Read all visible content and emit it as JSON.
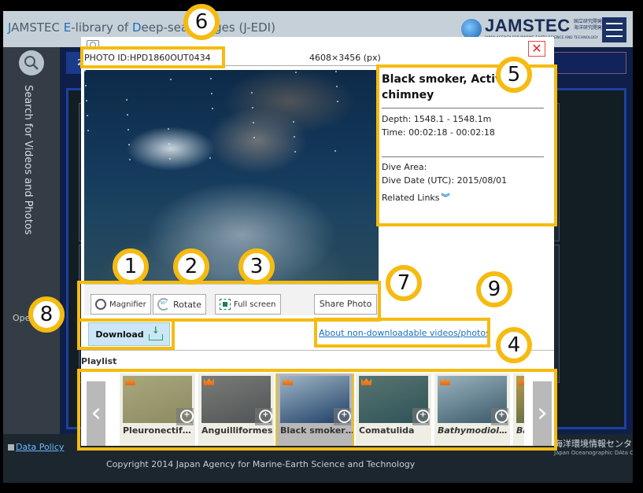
{
  "header": {
    "title_parts": [
      {
        "text": "J",
        "hl": true
      },
      {
        "text": "AMSTEC ",
        "hl": false
      },
      {
        "text": "E",
        "hl": true
      },
      {
        "text": "-library of ",
        "hl": false
      },
      {
        "text": "D",
        "hl": true
      },
      {
        "text": "eep-sea ",
        "hl": false
      },
      {
        "text": "I",
        "hl": true
      },
      {
        "text": "mages (J-EDI)",
        "hl": false
      }
    ],
    "logo_text": "JAMSTEC",
    "logo_jp": "国立研究開発法人 海洋研究開発機構",
    "logo_sub": "JAPAN AGENCY FOR MARINE-EARTH SCIENCE AND TECHNOLOGY",
    "menu_icon": "hamburger-menu-icon"
  },
  "sidebar": {
    "search_icon": "search-icon",
    "vertical_label": "Search for Videos and Photos",
    "open_label": "Ope"
  },
  "background_panel": {
    "tab_number": "2"
  },
  "modal": {
    "close_label": "✕",
    "photo_id": "PHOTO ID:HPD1860OUT0434",
    "dimensions": "4608×3456 (px)",
    "photo_alt": "Black smoker, Active chimney photo",
    "toolbar": {
      "magnifier": "Magnifier",
      "rotate": "Rotate",
      "rotate_badge": "90°",
      "fullscreen": "Full screen",
      "share": "Share Photo"
    },
    "download_label": "Download",
    "non_downloadable_link": "About non-downloadable videos/photos",
    "info": {
      "title": "Black smoker, Active chimney",
      "depth": "Depth: 1548.1 - 1548.1m",
      "time": "Time: 00:02:18 - 00:02:18",
      "dive_area": "Dive Area:",
      "dive_date": "Dive Date (UTC): 2015/08/01",
      "related_links": "Related Links",
      "related_icon": "≚"
    },
    "playlist": {
      "label": "Playlist",
      "prev_arrow": "‹",
      "next_arrow": "›",
      "items": [
        {
          "label": "Pleuronectif…",
          "italic": false,
          "active": false,
          "colors": [
            "#8c8a62",
            "#a9a77c"
          ]
        },
        {
          "label": "Anguilliformes",
          "italic": false,
          "active": false,
          "colors": [
            "#4e5355",
            "#7b7c78"
          ]
        },
        {
          "label": "Black smoker…",
          "italic": false,
          "active": true,
          "colors": [
            "#1d3d64",
            "#9fb6c6"
          ]
        },
        {
          "label": "Comatulida",
          "italic": false,
          "active": false,
          "colors": [
            "#2d5256",
            "#5a7572"
          ]
        },
        {
          "label": "Bathymodiol…",
          "italic": true,
          "active": false,
          "colors": [
            "#3a5868",
            "#9ab3bf"
          ]
        },
        {
          "label": "Ba",
          "italic": true,
          "active": false,
          "colors": [
            "#4a6040",
            "#b89a50"
          ]
        }
      ]
    }
  },
  "annotations": [
    {
      "number": "1"
    },
    {
      "number": "2"
    },
    {
      "number": "3"
    },
    {
      "number": "4"
    },
    {
      "number": "5"
    },
    {
      "number": "6"
    },
    {
      "number": "7"
    },
    {
      "number": "8"
    },
    {
      "number": "9"
    }
  ],
  "footer": {
    "data_policy": "Data Policy",
    "jodc_jp": "海洋環境情報センター",
    "jodc_en": "Japan Oceanographic DAta Center",
    "copyright": "Copyright 2014 Japan Agency for Marine-Earth Science and Technology"
  },
  "colors": {
    "annotation": "#f5bb11",
    "link": "#1a6fc4",
    "download_bg": "#cce6f8",
    "topbar": "#c6d0d8",
    "accent_blue": "#1c42a0"
  }
}
